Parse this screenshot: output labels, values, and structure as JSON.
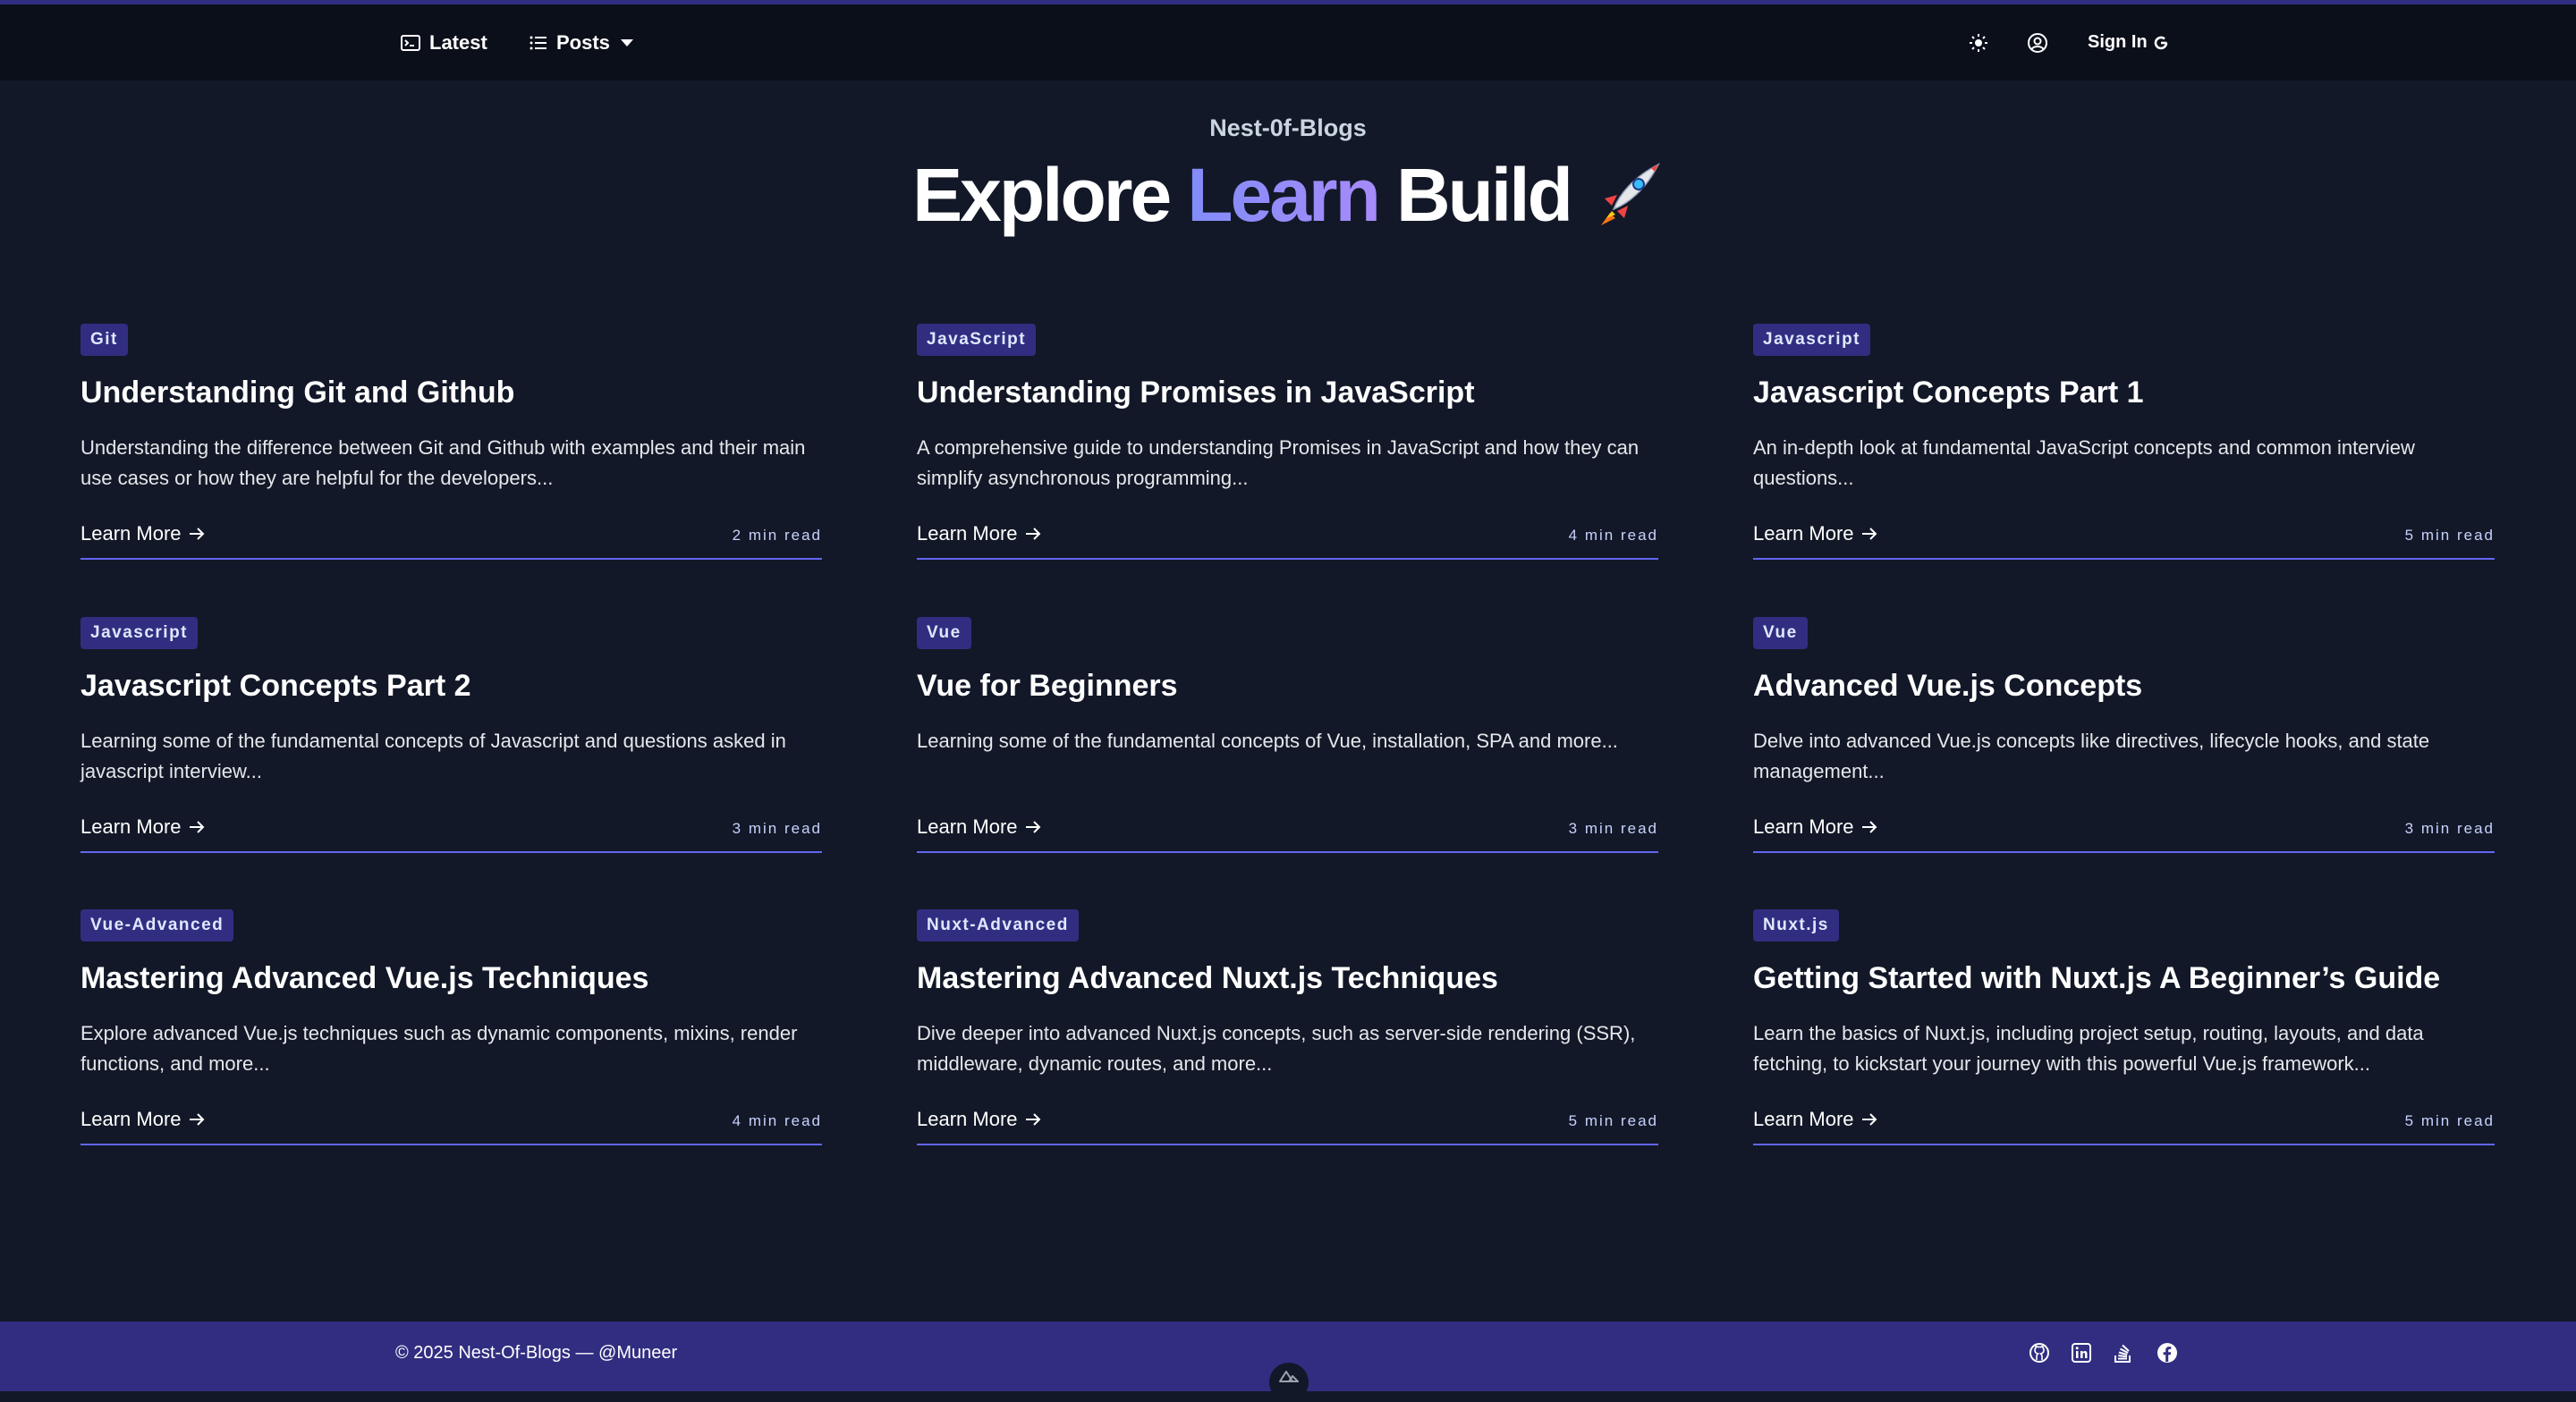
{
  "nav": {
    "latest_label": "Latest",
    "posts_label": "Posts",
    "signin_label": "Sign In",
    "icons": [
      "terminal-icon",
      "list-icon",
      "chevron-down-icon",
      "sun-icon",
      "user-circle-icon",
      "google-icon"
    ]
  },
  "hero": {
    "subtitle": "Nest-0f-Blogs",
    "title_word1": "Explore",
    "title_word2": "Learn",
    "title_word3": "Build",
    "title_emoji_icon": "rocket-icon"
  },
  "colors": {
    "background": "#121827",
    "navbar": "#0b0f1a",
    "accent": "#312e81",
    "accent_line": "#6366f1",
    "gradient_start": "#818cf8",
    "gradient_end": "#a78bfa"
  },
  "posts": [
    {
      "tag": "Git",
      "title": "Understanding Git and Github",
      "desc": "Understanding the difference between Git and Github with examples and their main use cases or how they are helpful for the developers...",
      "cta": "Learn More",
      "read": "2 min read"
    },
    {
      "tag": "JavaScript",
      "title": "Understanding Promises in JavaScript",
      "desc": "A comprehensive guide to understanding Promises in JavaScript and how they can simplify asynchronous programming...",
      "cta": "Learn More",
      "read": "4 min read"
    },
    {
      "tag": "Javascript",
      "title": "Javascript Concepts Part 1",
      "desc": "An in-depth look at fundamental JavaScript concepts and common interview questions...",
      "cta": "Learn More",
      "read": "5 min read"
    },
    {
      "tag": "Javascript",
      "title": "Javascript Concepts Part 2",
      "desc": "Learning some of the fundamental concepts of Javascript and questions asked in javascript interview...",
      "cta": "Learn More",
      "read": "3 min read"
    },
    {
      "tag": "Vue",
      "title": "Vue for Beginners",
      "desc": "Learning some of the fundamental concepts of Vue, installation, SPA and more...",
      "cta": "Learn More",
      "read": "3 min read"
    },
    {
      "tag": "Vue",
      "title": "Advanced Vue.js Concepts",
      "desc": "Delve into advanced Vue.js concepts like directives, lifecycle hooks, and state management...",
      "cta": "Learn More",
      "read": "3 min read"
    },
    {
      "tag": "Vue-Advanced",
      "title": "Mastering Advanced Vue.js Techniques",
      "desc": "Explore advanced Vue.js techniques such as dynamic components, mixins, render functions, and more...",
      "cta": "Learn More",
      "read": "4 min read"
    },
    {
      "tag": "Nuxt-Advanced",
      "title": "Mastering Advanced Nuxt.js Techniques",
      "desc": "Dive deeper into advanced Nuxt.js concepts, such as server-side rendering (SSR), middleware, dynamic routes, and more...",
      "cta": "Learn More",
      "read": "5 min read"
    },
    {
      "tag": "Nuxt.js",
      "title": "Getting Started with Nuxt.js A Beginner’s Guide",
      "desc": "Learn the basics of Nuxt.js, including project setup, routing, layouts, and data fetching, to kickstart your journey with this powerful Vue.js framework...",
      "cta": "Learn More",
      "read": "5 min read"
    }
  ],
  "footer": {
    "copyright": "© 2025 Nest-Of-Blogs — @Muneer",
    "social_icons": [
      "github-icon",
      "linkedin-icon",
      "stackoverflow-icon",
      "facebook-icon"
    ],
    "badge_icon": "nuxt-icon"
  }
}
